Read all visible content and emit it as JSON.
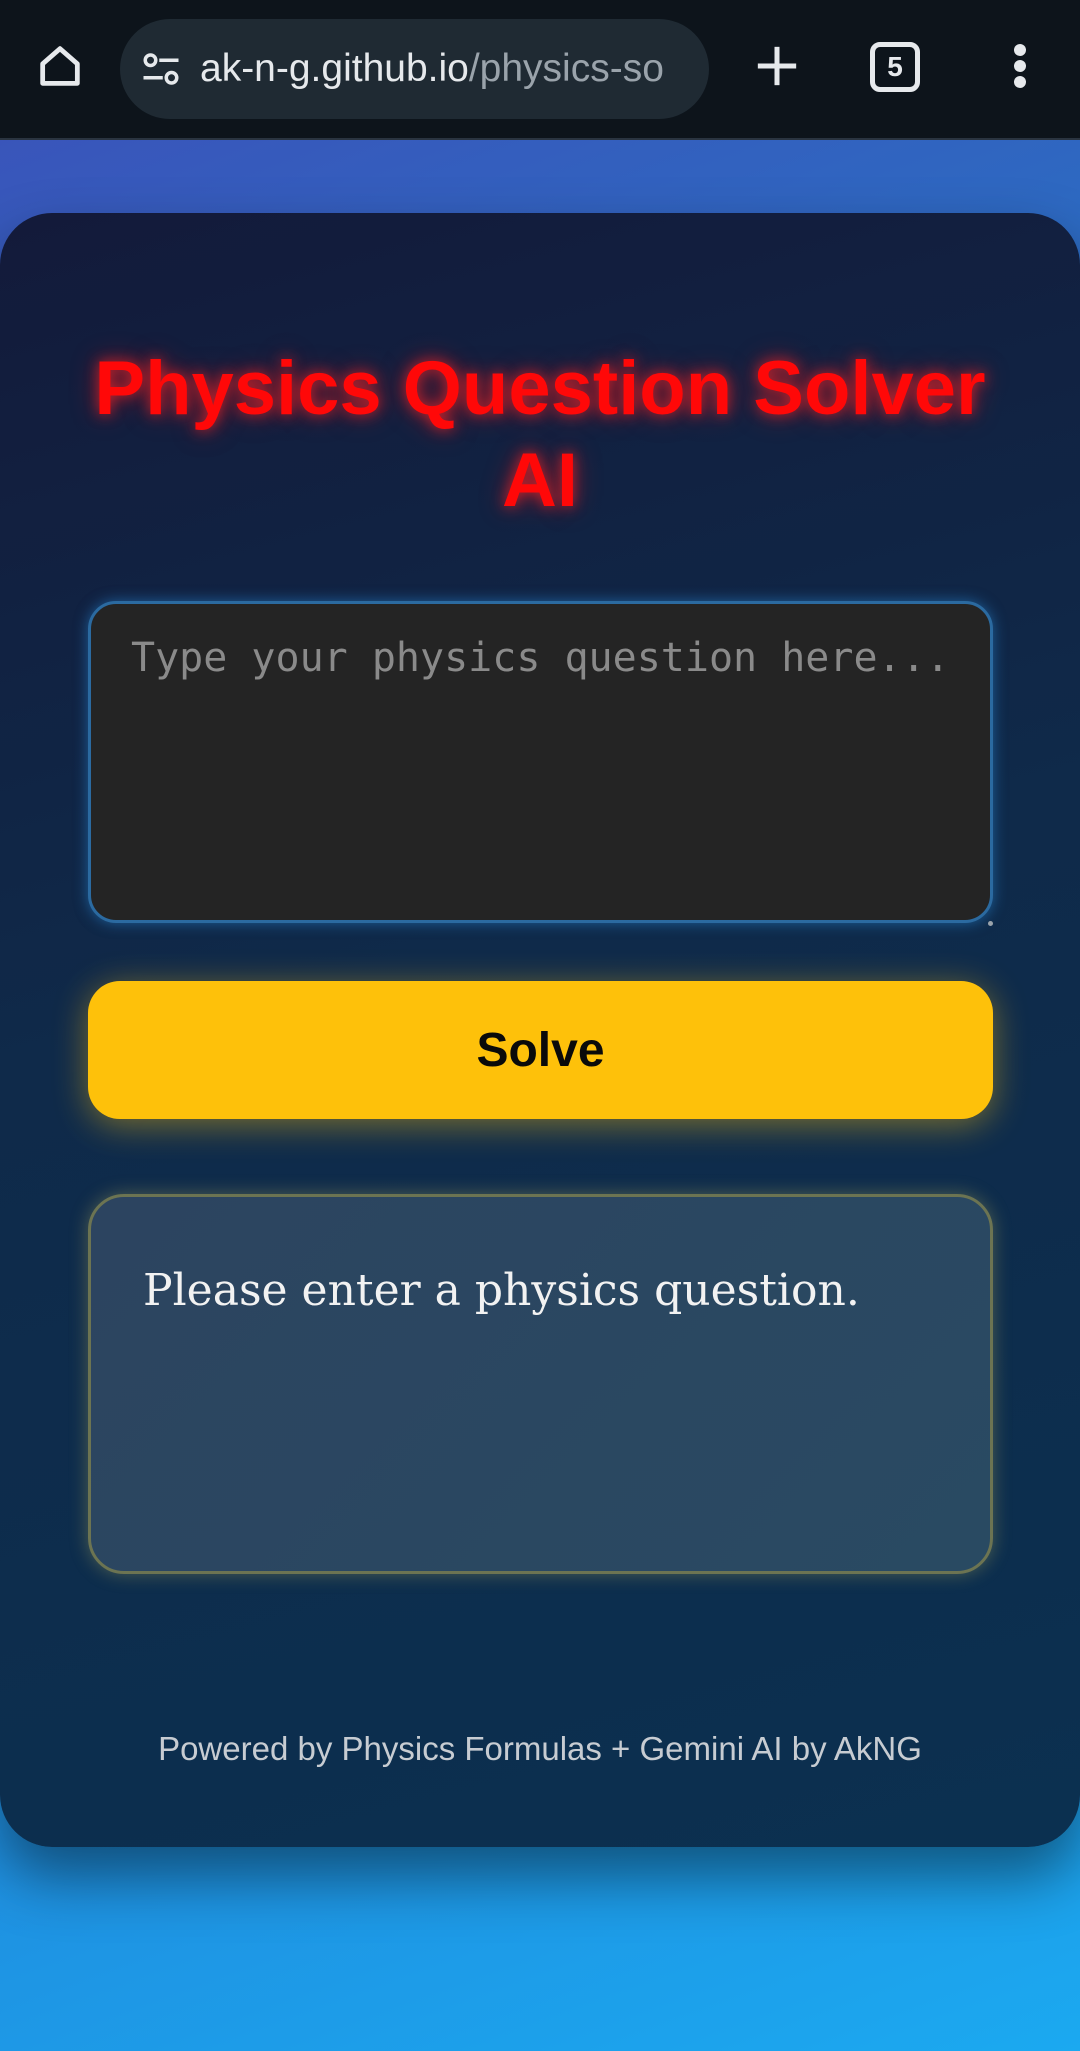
{
  "browser": {
    "url_host": "ak-n-g.github.io",
    "url_path": "/physics-so",
    "tab_count": "5",
    "icons": {
      "home": "home-icon",
      "site_settings": "tune-icon",
      "new_tab": "plus-icon",
      "tabs": "tab-switcher-icon",
      "menu": "more-vert-icon"
    }
  },
  "app": {
    "title": "Physics Question Solver AI",
    "question": {
      "value": "",
      "placeholder": "Type your physics question here..."
    },
    "solve_label": "Solve",
    "answer": "Please enter a physics question.",
    "footer": "Powered by Physics Formulas + Gemini AI by AkNG"
  },
  "colors": {
    "title": "#ff0808",
    "button": "#fec10a",
    "card": "#0f2a4a",
    "textarea_bg": "#242424"
  }
}
